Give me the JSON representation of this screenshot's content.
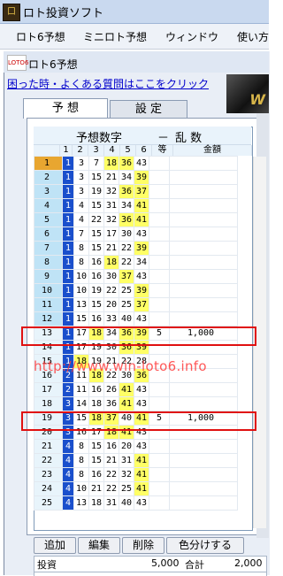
{
  "app": {
    "title": "ロト投資ソフト",
    "icon": "app-logo-icon"
  },
  "menu": [
    "ロト6予想",
    "ミニロト予想",
    "ウィンドウ",
    "使い方"
  ],
  "child_window": {
    "title": "ロト6予想",
    "icon_text": "LOTO6"
  },
  "help_link": "困った時・よくある質問はここをクリック",
  "tabs": [
    {
      "label": "予 想",
      "active": true
    },
    {
      "label": "設 定",
      "active": false
    }
  ],
  "grid": {
    "title_left": "予想数字",
    "title_dash": "－",
    "title_right": "乱  数",
    "headers": [
      "1",
      "2",
      "3",
      "4",
      "5",
      "6",
      "等",
      "金額"
    ],
    "rows": [
      {
        "no": "1",
        "nums": [
          "1",
          "3",
          "7",
          "18",
          "36",
          "43"
        ],
        "hl": [
          3,
          4
        ],
        "tou": "",
        "kin": ""
      },
      {
        "no": "2",
        "nums": [
          "1",
          "3",
          "15",
          "21",
          "34",
          "39"
        ],
        "hl": [
          5
        ],
        "tou": "",
        "kin": ""
      },
      {
        "no": "3",
        "nums": [
          "1",
          "3",
          "19",
          "32",
          "36",
          "37"
        ],
        "hl": [
          4,
          5
        ],
        "tou": "",
        "kin": ""
      },
      {
        "no": "4",
        "nums": [
          "1",
          "4",
          "15",
          "31",
          "34",
          "41"
        ],
        "hl": [
          5
        ],
        "tou": "",
        "kin": ""
      },
      {
        "no": "5",
        "nums": [
          "1",
          "4",
          "22",
          "32",
          "36",
          "41"
        ],
        "hl": [
          4,
          5
        ],
        "tou": "",
        "kin": ""
      },
      {
        "no": "6",
        "nums": [
          "1",
          "7",
          "15",
          "17",
          "30",
          "43"
        ],
        "hl": [],
        "tou": "",
        "kin": ""
      },
      {
        "no": "7",
        "nums": [
          "1",
          "8",
          "15",
          "21",
          "22",
          "39"
        ],
        "hl": [
          5
        ],
        "tou": "",
        "kin": ""
      },
      {
        "no": "8",
        "nums": [
          "1",
          "8",
          "16",
          "18",
          "22",
          "34"
        ],
        "hl": [
          3
        ],
        "tou": "",
        "kin": ""
      },
      {
        "no": "9",
        "nums": [
          "1",
          "10",
          "16",
          "30",
          "37",
          "43"
        ],
        "hl": [
          4
        ],
        "tou": "",
        "kin": ""
      },
      {
        "no": "10",
        "nums": [
          "1",
          "10",
          "19",
          "22",
          "25",
          "39"
        ],
        "hl": [
          5
        ],
        "tou": "",
        "kin": ""
      },
      {
        "no": "11",
        "nums": [
          "1",
          "13",
          "15",
          "20",
          "25",
          "37"
        ],
        "hl": [
          5
        ],
        "tou": "",
        "kin": ""
      },
      {
        "no": "12",
        "nums": [
          "1",
          "15",
          "16",
          "33",
          "40",
          "43"
        ],
        "hl": [],
        "tou": "",
        "kin": ""
      },
      {
        "no": "13",
        "nums": [
          "1",
          "17",
          "18",
          "34",
          "36",
          "39"
        ],
        "hl": [
          2,
          4,
          5
        ],
        "tou": "5",
        "kin": "1,000"
      },
      {
        "no": "14",
        "nums": [
          "1",
          "17",
          "19",
          "30",
          "36",
          "39"
        ],
        "hl": [
          4,
          5
        ],
        "tou": "",
        "kin": ""
      },
      {
        "no": "15",
        "nums": [
          "1",
          "18",
          "19",
          "21",
          "22",
          "28"
        ],
        "hl": [
          1
        ],
        "tou": "",
        "kin": ""
      },
      {
        "no": "16",
        "nums": [
          "2",
          "11",
          "18",
          "22",
          "30",
          "36"
        ],
        "hl": [
          2,
          5
        ],
        "tou": "",
        "kin": ""
      },
      {
        "no": "17",
        "nums": [
          "2",
          "11",
          "16",
          "26",
          "41",
          "43"
        ],
        "hl": [
          4
        ],
        "tou": "",
        "kin": ""
      },
      {
        "no": "18",
        "nums": [
          "3",
          "14",
          "18",
          "36",
          "41",
          "43"
        ],
        "hl": [
          4
        ],
        "tou": "",
        "kin": ""
      },
      {
        "no": "19",
        "nums": [
          "3",
          "15",
          "18",
          "37",
          "40",
          "41"
        ],
        "hl": [
          2,
          3,
          5
        ],
        "tou": "5",
        "kin": "1,000"
      },
      {
        "no": "20",
        "nums": [
          "3",
          "16",
          "17",
          "18",
          "41",
          "43"
        ],
        "hl": [
          3,
          4
        ],
        "tou": "",
        "kin": ""
      },
      {
        "no": "21",
        "nums": [
          "4",
          "8",
          "15",
          "16",
          "20",
          "43"
        ],
        "hl": [],
        "tou": "",
        "kin": ""
      },
      {
        "no": "22",
        "nums": [
          "4",
          "8",
          "15",
          "21",
          "31",
          "41"
        ],
        "hl": [
          5
        ],
        "tou": "",
        "kin": ""
      },
      {
        "no": "23",
        "nums": [
          "4",
          "8",
          "16",
          "22",
          "32",
          "41"
        ],
        "hl": [
          5
        ],
        "tou": "",
        "kin": ""
      },
      {
        "no": "24",
        "nums": [
          "4",
          "10",
          "21",
          "22",
          "25",
          "41"
        ],
        "hl": [
          5
        ],
        "tou": "",
        "kin": ""
      },
      {
        "no": "25",
        "nums": [
          "4",
          "13",
          "18",
          "31",
          "40",
          "43"
        ],
        "hl": [],
        "tou": "",
        "kin": ""
      }
    ]
  },
  "watermark": "http://www.win-loto6.info",
  "buttons": [
    "追加",
    "編集",
    "削除",
    "色分けする"
  ],
  "stats": {
    "invest_label": "投資",
    "invest_value": "5,000",
    "total_label": "合計",
    "total_value": "2,000"
  },
  "colors": {
    "highlight": "#ffff66",
    "col1": "#1a4fcc",
    "red_box": "#e01010"
  }
}
